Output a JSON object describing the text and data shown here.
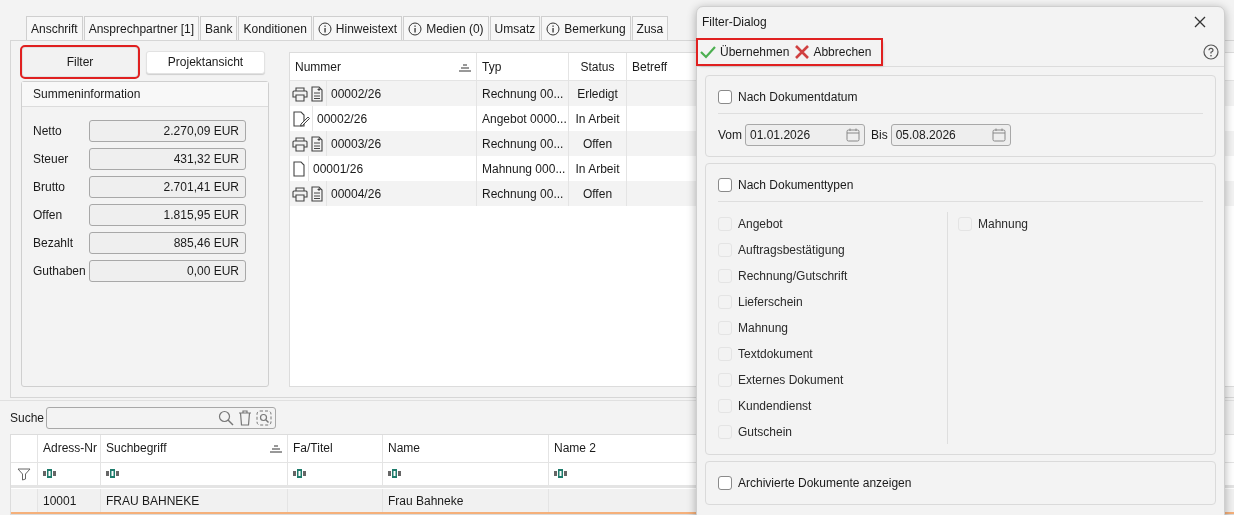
{
  "tabs": [
    {
      "label": "Anschrift",
      "info": false
    },
    {
      "label": "Ansprechpartner [1]",
      "info": false
    },
    {
      "label": "Bank",
      "info": false
    },
    {
      "label": "Konditionen",
      "info": false
    },
    {
      "label": "Hinweistext",
      "info": true
    },
    {
      "label": "Medien (0)",
      "info": true
    },
    {
      "label": "Umsatz",
      "info": false
    },
    {
      "label": "Bemerkung",
      "info": true
    },
    {
      "label": "Zusa",
      "info": false
    }
  ],
  "view_buttons": [
    {
      "label": "Filter",
      "highlighted": true
    },
    {
      "label": "Projektansicht",
      "highlighted": false
    }
  ],
  "summary": {
    "title": "Summeninformation",
    "rows": [
      {
        "label": "Netto",
        "value": "2.270,09 EUR"
      },
      {
        "label": "Steuer",
        "value": "431,32 EUR"
      },
      {
        "label": "Brutto",
        "value": "2.701,41 EUR"
      },
      {
        "label": "Offen",
        "value": "1.815,95 EUR"
      },
      {
        "label": "Bezahlt",
        "value": "885,46 EUR"
      },
      {
        "label": "Guthaben",
        "value": "0,00 EUR"
      }
    ]
  },
  "documents": {
    "columns": [
      "Nummer",
      "Typ",
      "Status",
      "Betreff"
    ],
    "rows": [
      {
        "kind": "printed",
        "number": "00002/26",
        "type": "Rechnung 00...",
        "status": "Erledigt"
      },
      {
        "kind": "edited",
        "number": "00002/26",
        "type": "Angebot 0000...",
        "status": "In Arbeit"
      },
      {
        "kind": "printed",
        "number": "00003/26",
        "type": "Rechnung 00...",
        "status": "Offen"
      },
      {
        "kind": "plain",
        "number": "00001/26",
        "type": "Mahnung 000...",
        "status": "In Arbeit"
      },
      {
        "kind": "printed",
        "number": "00004/26",
        "type": "Rechnung 00...",
        "status": "Offen"
      }
    ]
  },
  "search": {
    "label": "Suche"
  },
  "addresses": {
    "columns": [
      "Adress-Nr",
      "Suchbegriff",
      "Fa/Titel",
      "Name",
      "Name 2"
    ],
    "rows": [
      {
        "cells": [
          "10001",
          "FRAU BAHNEKE",
          "",
          "Frau Bahneke",
          ""
        ]
      }
    ]
  },
  "dialog": {
    "title": "Filter-Dialog",
    "actions": [
      {
        "kind": "apply",
        "label": "Übernehmen"
      },
      {
        "kind": "cancel",
        "label": "Abbrechen"
      }
    ],
    "actions_highlighted": true,
    "date_filter": {
      "label": "Nach Dokumentdatum",
      "checked": false,
      "from_label": "Vom",
      "from": "01.01.2026",
      "to_label": "Bis",
      "to": "05.08.2026"
    },
    "type_filter": {
      "label": "Nach Dokumenttypen",
      "checked": false,
      "left": [
        {
          "label": "Angebot",
          "checked": false,
          "disabled": true
        },
        {
          "label": "Auftragsbestätigung",
          "checked": false,
          "disabled": true
        },
        {
          "label": "Rechnung/Gutschrift",
          "checked": false,
          "disabled": true
        },
        {
          "label": "Lieferschein",
          "checked": false,
          "disabled": true
        },
        {
          "label": "Mahnung",
          "checked": false,
          "disabled": true
        },
        {
          "label": "Textdokument",
          "checked": false,
          "disabled": true
        },
        {
          "label": "Externes Dokument",
          "checked": false,
          "disabled": true
        },
        {
          "label": "Kundendienst",
          "checked": false,
          "disabled": true
        },
        {
          "label": "Gutschein",
          "checked": false,
          "disabled": true
        }
      ],
      "right": [
        {
          "label": "Mahnung",
          "checked": false,
          "disabled": true
        }
      ]
    },
    "archive": {
      "label": "Archivierte Dokumente anzeigen",
      "checked": false
    }
  }
}
